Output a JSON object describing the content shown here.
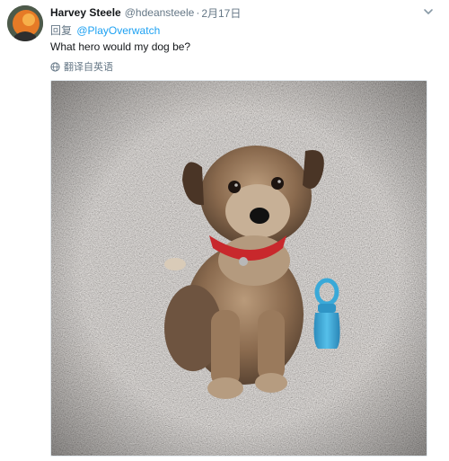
{
  "tweet": {
    "author_name": "Harvey Steele",
    "handle": "@hdeansteele",
    "separator": "·",
    "time": "2月17日",
    "reply_prefix": "回复",
    "reply_mention": "@PlayOverwatch",
    "text": "What hero would my dog be?",
    "translate_label": "翻译自英语"
  },
  "icons": {
    "caret": "chevron-down-icon",
    "translate": "globe-icon"
  },
  "colors": {
    "link": "#1da1f2",
    "secondary_text": "#657786",
    "primary_text": "#14171a",
    "carpet": "#8e8a86",
    "toy": "#3aa9d8",
    "collar": "#c8282c"
  }
}
